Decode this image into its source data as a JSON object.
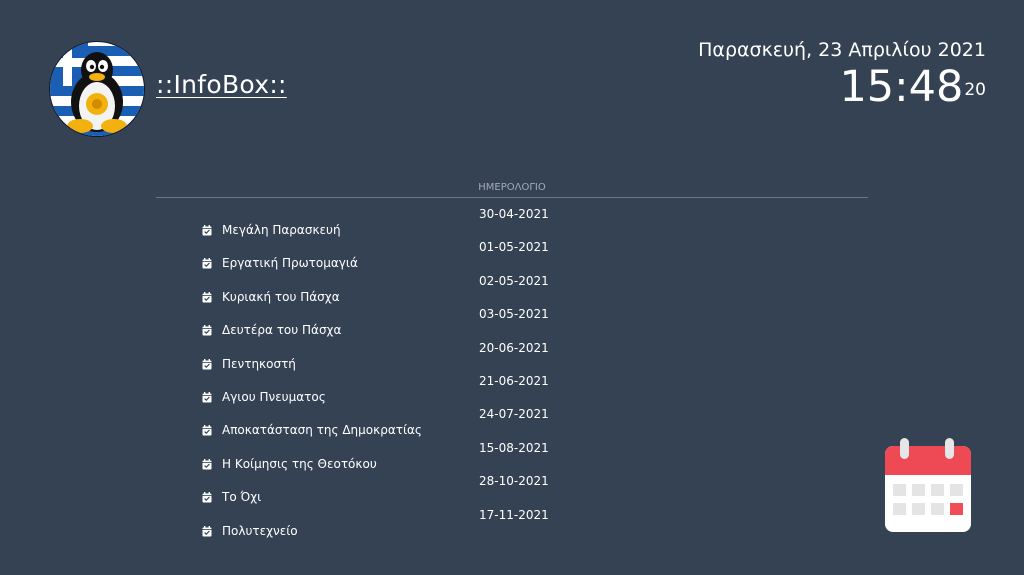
{
  "header": {
    "brand": "::InfoBox::",
    "date": "Παρασκευή, 23 Απριλίου 2021",
    "time": "15:48",
    "seconds": "20"
  },
  "calendar": {
    "title": "ΗΜΕΡΟΛΟΓΙΟ",
    "events": [
      {
        "date": "30-04-2021",
        "name": "Μεγάλη Παρασκευή"
      },
      {
        "date": "01-05-2021",
        "name": "Εργατική Πρωτομαγιά"
      },
      {
        "date": "02-05-2021",
        "name": "Κυριακή του Πάσχα"
      },
      {
        "date": "03-05-2021",
        "name": "Δευτέρα του Πάσχα"
      },
      {
        "date": "20-06-2021",
        "name": "Πεντηκοστή"
      },
      {
        "date": "21-06-2021",
        "name": "Αγιου Πνευματος"
      },
      {
        "date": "24-07-2021",
        "name": "Αποκατάσταση της Δημοκρατίας"
      },
      {
        "date": "15-08-2021",
        "name": "Η Κοίμησις της Θεοτόκου"
      },
      {
        "date": "28-10-2021",
        "name": "Το Όχι"
      },
      {
        "date": "17-11-2021",
        "name": "Πολυτεχνείο"
      }
    ]
  },
  "icons": {
    "logo": "tux-greek-flag-logo",
    "event": "calendar-check-icon",
    "widget": "calendar-icon"
  },
  "colors": {
    "background": "#354254",
    "calendar_red": "#ee4a55",
    "calendar_highlight": "#f24c57"
  }
}
